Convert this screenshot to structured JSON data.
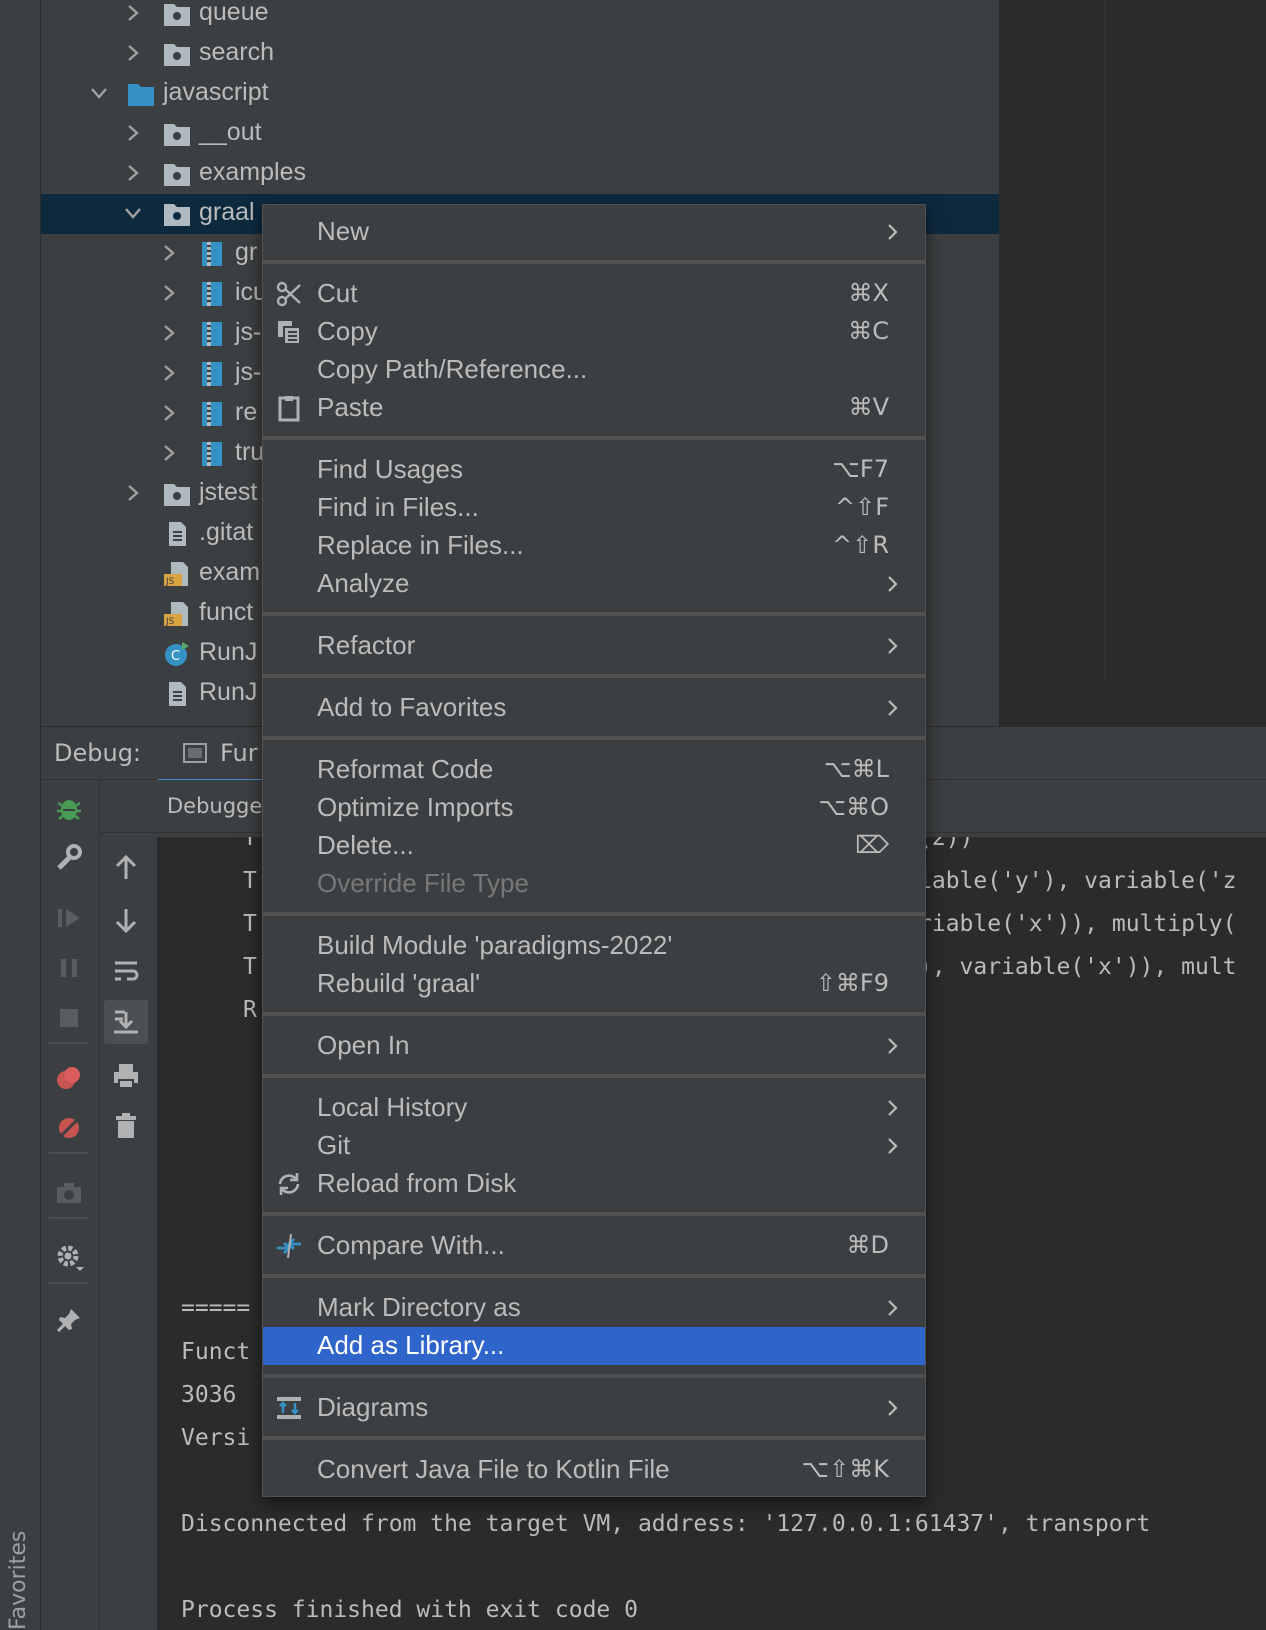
{
  "tree": {
    "items": [
      {
        "label": "queue"
      },
      {
        "label": "search"
      },
      {
        "label": "javascript"
      },
      {
        "label": "__out"
      },
      {
        "label": "examples"
      },
      {
        "label": "graal"
      },
      {
        "label": "gr"
      },
      {
        "label": "icu"
      },
      {
        "label": "js-"
      },
      {
        "label": "js-"
      },
      {
        "label": "re"
      },
      {
        "label": "tru"
      },
      {
        "label": "jstest"
      },
      {
        "label": ".gitat"
      },
      {
        "label": "exam"
      },
      {
        "label": "funct"
      },
      {
        "label": "RunJ"
      },
      {
        "label": "RunJ"
      }
    ]
  },
  "debug": {
    "title": "Debug:",
    "tab_label": "Fur",
    "debugger_tab": "Debugger"
  },
  "console": {
    "lines": [
      "T",
      "T",
      "T",
      "T",
      "R",
      "=====",
      "Funct",
      "3036 ",
      "Versi",
      "Disconnected from the target VM, address: '127.0.0.1:61437', transport",
      "Process finished with exit code 0"
    ],
    "right_fragments": [
      "(2))",
      "iable('y'), variable('z",
      "riable('x')), multiply(",
      "), variable('x')), mult"
    ]
  },
  "sidebar": {
    "favorites_label": "Favorites"
  },
  "menu": {
    "items": [
      {
        "label": "New"
      },
      {
        "label": "Cut",
        "shortcut": "⌘X",
        "icon": "scissors-icon"
      },
      {
        "label": "Copy",
        "shortcut": "⌘C",
        "icon": "copy-icon"
      },
      {
        "label": "Copy Path/Reference..."
      },
      {
        "label": "Paste",
        "shortcut": "⌘V",
        "icon": "clipboard-icon"
      },
      {
        "label": "Find Usages",
        "shortcut": "⌥F7"
      },
      {
        "label": "Find in Files...",
        "shortcut": "^⇧F"
      },
      {
        "label": "Replace in Files...",
        "shortcut": "^⇧R"
      },
      {
        "label": "Analyze"
      },
      {
        "label": "Refactor"
      },
      {
        "label": "Add to Favorites"
      },
      {
        "label": "Reformat Code",
        "shortcut": "⌥⌘L"
      },
      {
        "label": "Optimize Imports",
        "shortcut": "⌥⌘O"
      },
      {
        "label": "Delete...",
        "shortcut": "⌦"
      },
      {
        "label": "Override File Type"
      },
      {
        "label": "Build Module 'paradigms-2022'"
      },
      {
        "label": "Rebuild 'graal'",
        "shortcut": "⇧⌘F9"
      },
      {
        "label": "Open In"
      },
      {
        "label": "Local History"
      },
      {
        "label": "Git"
      },
      {
        "label": "Reload from Disk",
        "icon": "reload-icon"
      },
      {
        "label": "Compare With...",
        "shortcut": "⌘D",
        "icon": "compare-icon"
      },
      {
        "label": "Mark Directory as"
      },
      {
        "label": "Add as Library..."
      },
      {
        "label": "Diagrams",
        "icon": "diagram-icon"
      },
      {
        "label": "Convert Java File to Kotlin File",
        "shortcut": "⌥⇧⌘K"
      }
    ]
  },
  "colors": {
    "menu_highlight": "#2f65ca",
    "selection": "#0d293e",
    "folder_blue": "#3592c4",
    "folder_gray": "#aeb9c0"
  }
}
